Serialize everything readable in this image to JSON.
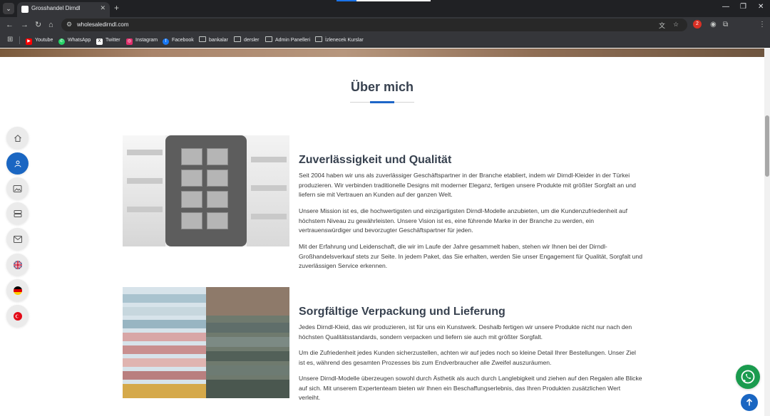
{
  "browser": {
    "tab_title": "Grosshandel Dirndl",
    "tab_close": "✕",
    "new_tab": "+",
    "url": "wholesaledirndl.com",
    "extension_badge": "2",
    "bookmarks": [
      {
        "label": "Youtube",
        "icon": "youtube-icon",
        "color": "#ff0000"
      },
      {
        "label": "WhatsApp",
        "icon": "whatsapp-icon",
        "color": "#25d366"
      },
      {
        "label": "Twitter",
        "icon": "x-twitter-icon",
        "color": "#000000"
      },
      {
        "label": "Instagram",
        "icon": "instagram-icon",
        "color": "#e1306c"
      },
      {
        "label": "Facebook",
        "icon": "facebook-icon",
        "color": "#1877f2"
      },
      {
        "label": "bankalar",
        "icon": "folder-icon"
      },
      {
        "label": "dersler",
        "icon": "folder-icon"
      },
      {
        "label": "Admin Panelleri",
        "icon": "folder-icon"
      },
      {
        "label": "İzlenecek Kurslar",
        "icon": "folder-icon"
      }
    ]
  },
  "page": {
    "section_title": "Über mich",
    "accent_color": "#1e66c8",
    "sidenav": [
      {
        "name": "home",
        "icon": "home-icon",
        "active": false
      },
      {
        "name": "about",
        "icon": "user-icon",
        "active": true
      },
      {
        "name": "gallery",
        "icon": "image-icon",
        "active": false
      },
      {
        "name": "services",
        "icon": "server-icon",
        "active": false
      },
      {
        "name": "contact",
        "icon": "mail-icon",
        "active": false
      },
      {
        "name": "lang-en",
        "icon": "uk-flag-icon",
        "active": false
      },
      {
        "name": "lang-de",
        "icon": "germany-flag-icon",
        "active": false
      },
      {
        "name": "lang-tr",
        "icon": "turkey-flag-icon",
        "active": false
      }
    ],
    "blocks": [
      {
        "heading": "Zuverlässigkeit und Qualität",
        "paragraphs": [
          "Seit 2004 haben wir uns als zuverlässiger Geschäftspartner in der Branche etabliert, indem wir Dirndl-Kleider in der Türkei produzieren. Wir verbinden traditionelle Designs mit moderner Eleganz, fertigen unsere Produkte mit größter Sorgfalt an und liefern sie mit Vertrauen an Kunden auf der ganzen Welt.",
          "Unsere Mission ist es, die hochwertigsten und einzigartigsten Dirndl-Modelle anzubieten, um die Kundenzufriedenheit auf höchstem Niveau zu gewährleisten. Unsere Vision ist es, eine führende Marke in der Branche zu werden, ein vertrauenswürdiger und bevorzugter Geschäftspartner für jeden.",
          "Mit der Erfahrung und Leidenschaft, die wir im Laufe der Jahre gesammelt haben, stehen wir Ihnen bei der Dirndl-Großhandelsverkauf stets zur Seite. In jedem Paket, das Sie erhalten, werden Sie unser Engagement für Qualität, Sorgfalt und zuverlässigen Service erkennen."
        ]
      },
      {
        "heading": "Sorgfältige Verpackung und Lieferung",
        "paragraphs": [
          "Jedes Dirndl-Kleid, das wir produzieren, ist für uns ein Kunstwerk. Deshalb fertigen wir unsere Produkte nicht nur nach den höchsten Qualitätsstandards, sondern verpacken und liefern sie auch mit größter Sorgfalt.",
          "Um die Zufriedenheit jedes Kunden sicherzustellen, achten wir auf jedes noch so kleine Detail Ihrer Bestellungen. Unser Ziel ist es, während des gesamten Prozesses bis zum Endverbraucher alle Zweifel auszuräumen.",
          "Unsere Dirndl-Modelle überzeugen sowohl durch Ästhetik als auch durch Langlebigkeit und ziehen auf den Regalen alle Blicke auf sich. Mit unserem Expertenteam bieten wir Ihnen ein Beschaffungserlebnis, das Ihren Produkten zusätzlichen Wert verleiht."
        ]
      }
    ],
    "floating": {
      "whatsapp_color": "#1a9b4e",
      "scroll_top_color": "#1a66c2"
    }
  }
}
